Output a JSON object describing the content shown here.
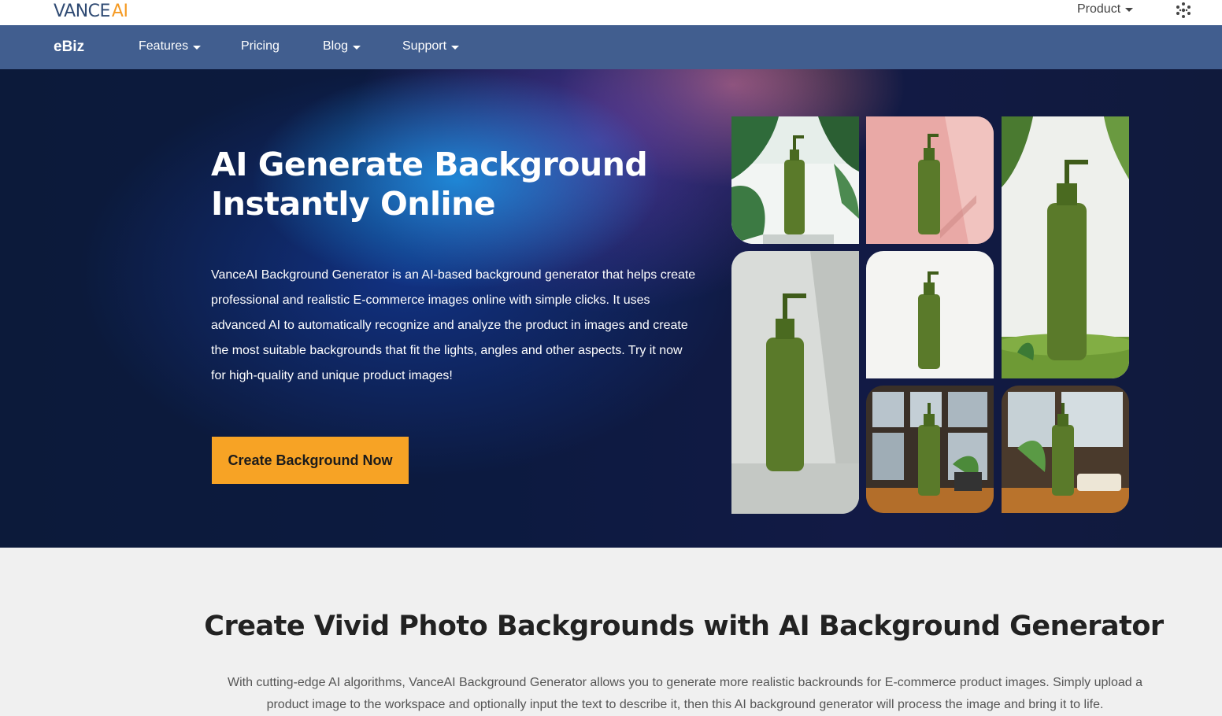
{
  "topbar": {
    "logo_main": "VANCE",
    "logo_accent": "AI",
    "product_label": "Product"
  },
  "nav": {
    "brand": "eBiz",
    "items": [
      {
        "label": "Features",
        "dropdown": true
      },
      {
        "label": "Pricing",
        "dropdown": false
      },
      {
        "label": "Blog",
        "dropdown": true
      },
      {
        "label": "Support",
        "dropdown": true
      }
    ]
  },
  "hero": {
    "title_line1": "AI Generate Background",
    "title_line2": "Instantly Online",
    "description": "VanceAI Background Generator is an AI-based background generator that helps create professional and realistic E-commerce images online with simple clicks. It uses advanced AI to automatically recognize and analyze the product in images and create the most suitable backgrounds that fit the lights, angles and other aspects. Try it now for high-quality and unique product images!",
    "cta_label": "Create Background Now"
  },
  "section2": {
    "title": "Create Vivid Photo Backgrounds with AI Background Generator",
    "description": "With cutting-edge AI algorithms, VanceAI Background Generator allows you to generate more realistic backrounds for E-commerce product images. Simply upload a product image to the workspace and optionally input the text to describe it, then this AI background generator will process the image and bring it to life."
  },
  "colors": {
    "nav_bg": "#415e8f",
    "cta_bg": "#f7a325",
    "logo_accent": "#f59a23",
    "bottle": "#5a7a2a"
  },
  "icons": {
    "apps": "apps-grid-icon",
    "caret": "chevron-down-icon"
  }
}
